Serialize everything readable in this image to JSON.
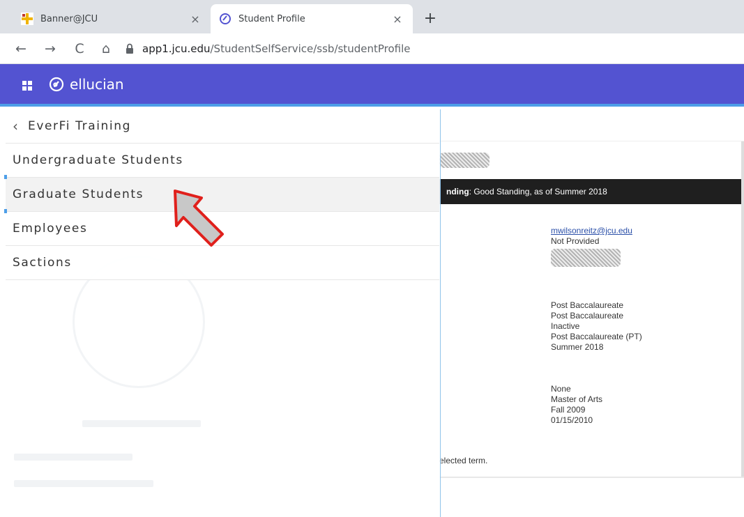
{
  "browser": {
    "tabs": [
      {
        "title": "Banner@JCU",
        "icon": "banner-cross-icon",
        "active": false
      },
      {
        "title": "Student Profile",
        "icon": "ellucian-logo-icon",
        "active": true
      }
    ],
    "close_glyph": "×",
    "new_tab_glyph": "+",
    "address": {
      "host": "app1.jcu.edu",
      "path": "/StudentSelfService/ssb/studentProfile"
    },
    "nav": {
      "back": "←",
      "forward": "→",
      "reload": "C",
      "home": "⌂"
    }
  },
  "app": {
    "brand": "ellucian",
    "header_color": "#5353d1",
    "accent_color": "#4d9ee8"
  },
  "menu": {
    "back_glyph": "‹",
    "back_label": "EverFi Training",
    "items": [
      {
        "label": "Undergraduate Students"
      },
      {
        "label": "Graduate Students"
      },
      {
        "label": "Employees"
      },
      {
        "label": "Sactions"
      }
    ]
  },
  "profile": {
    "standing_prefix": "nding",
    "standing_text": ": Good Standing, as of Summer 2018",
    "email": "mwilsonreitz@jcu.edu",
    "phone": "Not Provided",
    "general": [
      "Post Baccalaureate",
      "Post Baccalaureate",
      "Inactive",
      "Post Baccalaureate (PT)",
      "Summer 2018"
    ],
    "graduation": [
      "None",
      "Master of Arts",
      "Fall 2009",
      "01/15/2010"
    ],
    "footer_note": "elected term."
  }
}
